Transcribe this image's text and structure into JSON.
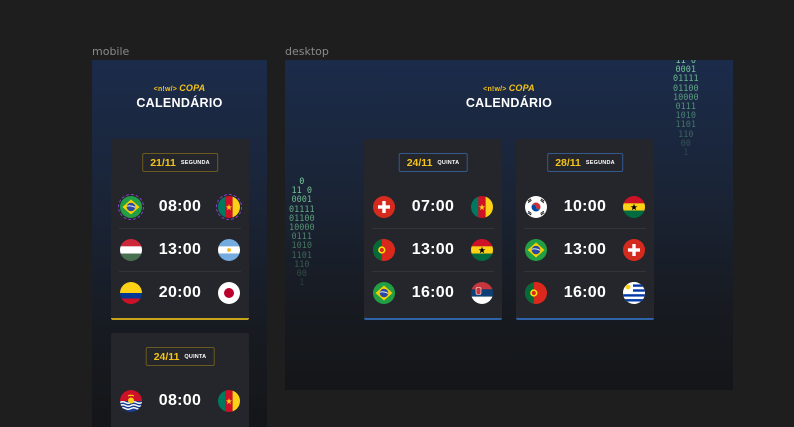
{
  "frames": {
    "mobile_label": "mobile",
    "desktop_label": "desktop"
  },
  "brand": {
    "prefix": "<n!w/>",
    "name": "COPA"
  },
  "title": "CALENDÁRIO",
  "binary_left": [
    "0",
    "11 0",
    "0001",
    "01111",
    "01100",
    "10000",
    "0111",
    "1010",
    "1101",
    "110",
    "00",
    "1"
  ],
  "binary_right": [
    "11 0",
    "0001",
    "01111",
    "01100",
    "10000",
    "0111",
    "1010",
    "1101",
    "110",
    "00",
    "1"
  ],
  "mobile_days": [
    {
      "date": "21/11",
      "weekday": "SEGUNDA",
      "matches": [
        {
          "time": "08:00",
          "home": "brazil-flag-icon",
          "away": "cameroon-flag-icon"
        },
        {
          "time": "13:00",
          "home": "hungary-flag-icon",
          "away": "argentina-flag-icon"
        },
        {
          "time": "20:00",
          "home": "colombia-flag-icon",
          "away": "japan-flag-icon"
        }
      ]
    },
    {
      "date": "24/11",
      "weekday": "QUINTA",
      "matches": [
        {
          "time": "08:00",
          "home": "kiribati-flag-icon",
          "away": "cameroon-flag-icon"
        }
      ]
    }
  ],
  "desktop_days": [
    {
      "date": "24/11",
      "weekday": "QUINTA",
      "matches": [
        {
          "time": "07:00",
          "home": "switzerland-flag-icon",
          "away": "cameroon-flag-icon"
        },
        {
          "time": "13:00",
          "home": "portugal-flag-icon",
          "away": "ghana-flag-icon"
        },
        {
          "time": "16:00",
          "home": "brazil-flag-icon",
          "away": "serbia-flag-icon"
        }
      ]
    },
    {
      "date": "28/11",
      "weekday": "SEGUNDA",
      "matches": [
        {
          "time": "10:00",
          "home": "south-korea-flag-icon",
          "away": "ghana-flag-icon"
        },
        {
          "time": "13:00",
          "home": "brazil-flag-icon",
          "away": "switzerland-flag-icon"
        },
        {
          "time": "16:00",
          "home": "portugal-flag-icon",
          "away": "uruguay-flag-icon"
        }
      ]
    }
  ],
  "colors": {
    "accent_gold": "#f2c31b",
    "accent_blue": "#2f63a8",
    "card_bg": "#25262b",
    "selection": "#8c3fd6"
  }
}
